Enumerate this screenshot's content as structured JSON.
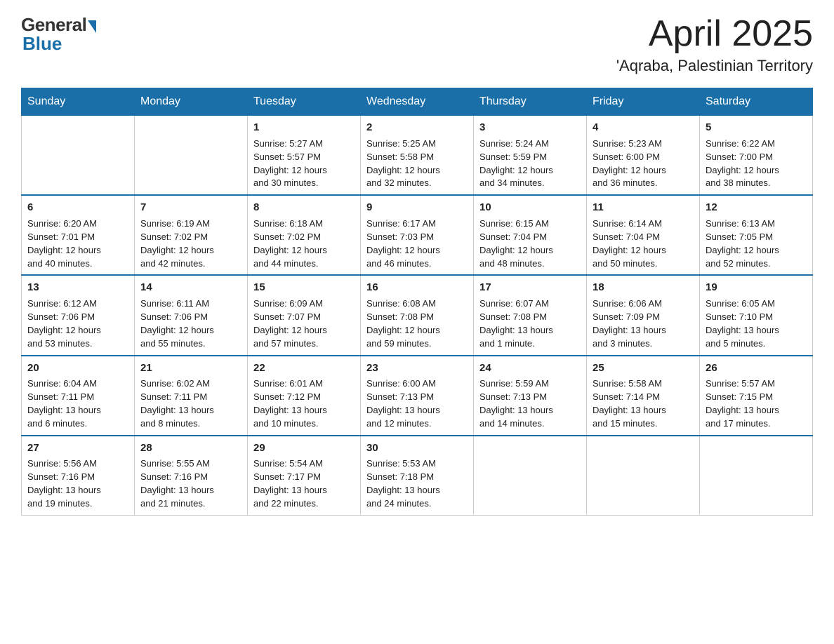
{
  "header": {
    "logo_general": "General",
    "logo_blue": "Blue",
    "month_title": "April 2025",
    "location": "'Aqraba, Palestinian Territory"
  },
  "days_of_week": [
    "Sunday",
    "Monday",
    "Tuesday",
    "Wednesday",
    "Thursday",
    "Friday",
    "Saturday"
  ],
  "weeks": [
    [
      {
        "day": "",
        "info": ""
      },
      {
        "day": "",
        "info": ""
      },
      {
        "day": "1",
        "info": "Sunrise: 5:27 AM\nSunset: 5:57 PM\nDaylight: 12 hours\nand 30 minutes."
      },
      {
        "day": "2",
        "info": "Sunrise: 5:25 AM\nSunset: 5:58 PM\nDaylight: 12 hours\nand 32 minutes."
      },
      {
        "day": "3",
        "info": "Sunrise: 5:24 AM\nSunset: 5:59 PM\nDaylight: 12 hours\nand 34 minutes."
      },
      {
        "day": "4",
        "info": "Sunrise: 5:23 AM\nSunset: 6:00 PM\nDaylight: 12 hours\nand 36 minutes."
      },
      {
        "day": "5",
        "info": "Sunrise: 6:22 AM\nSunset: 7:00 PM\nDaylight: 12 hours\nand 38 minutes."
      }
    ],
    [
      {
        "day": "6",
        "info": "Sunrise: 6:20 AM\nSunset: 7:01 PM\nDaylight: 12 hours\nand 40 minutes."
      },
      {
        "day": "7",
        "info": "Sunrise: 6:19 AM\nSunset: 7:02 PM\nDaylight: 12 hours\nand 42 minutes."
      },
      {
        "day": "8",
        "info": "Sunrise: 6:18 AM\nSunset: 7:02 PM\nDaylight: 12 hours\nand 44 minutes."
      },
      {
        "day": "9",
        "info": "Sunrise: 6:17 AM\nSunset: 7:03 PM\nDaylight: 12 hours\nand 46 minutes."
      },
      {
        "day": "10",
        "info": "Sunrise: 6:15 AM\nSunset: 7:04 PM\nDaylight: 12 hours\nand 48 minutes."
      },
      {
        "day": "11",
        "info": "Sunrise: 6:14 AM\nSunset: 7:04 PM\nDaylight: 12 hours\nand 50 minutes."
      },
      {
        "day": "12",
        "info": "Sunrise: 6:13 AM\nSunset: 7:05 PM\nDaylight: 12 hours\nand 52 minutes."
      }
    ],
    [
      {
        "day": "13",
        "info": "Sunrise: 6:12 AM\nSunset: 7:06 PM\nDaylight: 12 hours\nand 53 minutes."
      },
      {
        "day": "14",
        "info": "Sunrise: 6:11 AM\nSunset: 7:06 PM\nDaylight: 12 hours\nand 55 minutes."
      },
      {
        "day": "15",
        "info": "Sunrise: 6:09 AM\nSunset: 7:07 PM\nDaylight: 12 hours\nand 57 minutes."
      },
      {
        "day": "16",
        "info": "Sunrise: 6:08 AM\nSunset: 7:08 PM\nDaylight: 12 hours\nand 59 minutes."
      },
      {
        "day": "17",
        "info": "Sunrise: 6:07 AM\nSunset: 7:08 PM\nDaylight: 13 hours\nand 1 minute."
      },
      {
        "day": "18",
        "info": "Sunrise: 6:06 AM\nSunset: 7:09 PM\nDaylight: 13 hours\nand 3 minutes."
      },
      {
        "day": "19",
        "info": "Sunrise: 6:05 AM\nSunset: 7:10 PM\nDaylight: 13 hours\nand 5 minutes."
      }
    ],
    [
      {
        "day": "20",
        "info": "Sunrise: 6:04 AM\nSunset: 7:11 PM\nDaylight: 13 hours\nand 6 minutes."
      },
      {
        "day": "21",
        "info": "Sunrise: 6:02 AM\nSunset: 7:11 PM\nDaylight: 13 hours\nand 8 minutes."
      },
      {
        "day": "22",
        "info": "Sunrise: 6:01 AM\nSunset: 7:12 PM\nDaylight: 13 hours\nand 10 minutes."
      },
      {
        "day": "23",
        "info": "Sunrise: 6:00 AM\nSunset: 7:13 PM\nDaylight: 13 hours\nand 12 minutes."
      },
      {
        "day": "24",
        "info": "Sunrise: 5:59 AM\nSunset: 7:13 PM\nDaylight: 13 hours\nand 14 minutes."
      },
      {
        "day": "25",
        "info": "Sunrise: 5:58 AM\nSunset: 7:14 PM\nDaylight: 13 hours\nand 15 minutes."
      },
      {
        "day": "26",
        "info": "Sunrise: 5:57 AM\nSunset: 7:15 PM\nDaylight: 13 hours\nand 17 minutes."
      }
    ],
    [
      {
        "day": "27",
        "info": "Sunrise: 5:56 AM\nSunset: 7:16 PM\nDaylight: 13 hours\nand 19 minutes."
      },
      {
        "day": "28",
        "info": "Sunrise: 5:55 AM\nSunset: 7:16 PM\nDaylight: 13 hours\nand 21 minutes."
      },
      {
        "day": "29",
        "info": "Sunrise: 5:54 AM\nSunset: 7:17 PM\nDaylight: 13 hours\nand 22 minutes."
      },
      {
        "day": "30",
        "info": "Sunrise: 5:53 AM\nSunset: 7:18 PM\nDaylight: 13 hours\nand 24 minutes."
      },
      {
        "day": "",
        "info": ""
      },
      {
        "day": "",
        "info": ""
      },
      {
        "day": "",
        "info": ""
      }
    ]
  ]
}
